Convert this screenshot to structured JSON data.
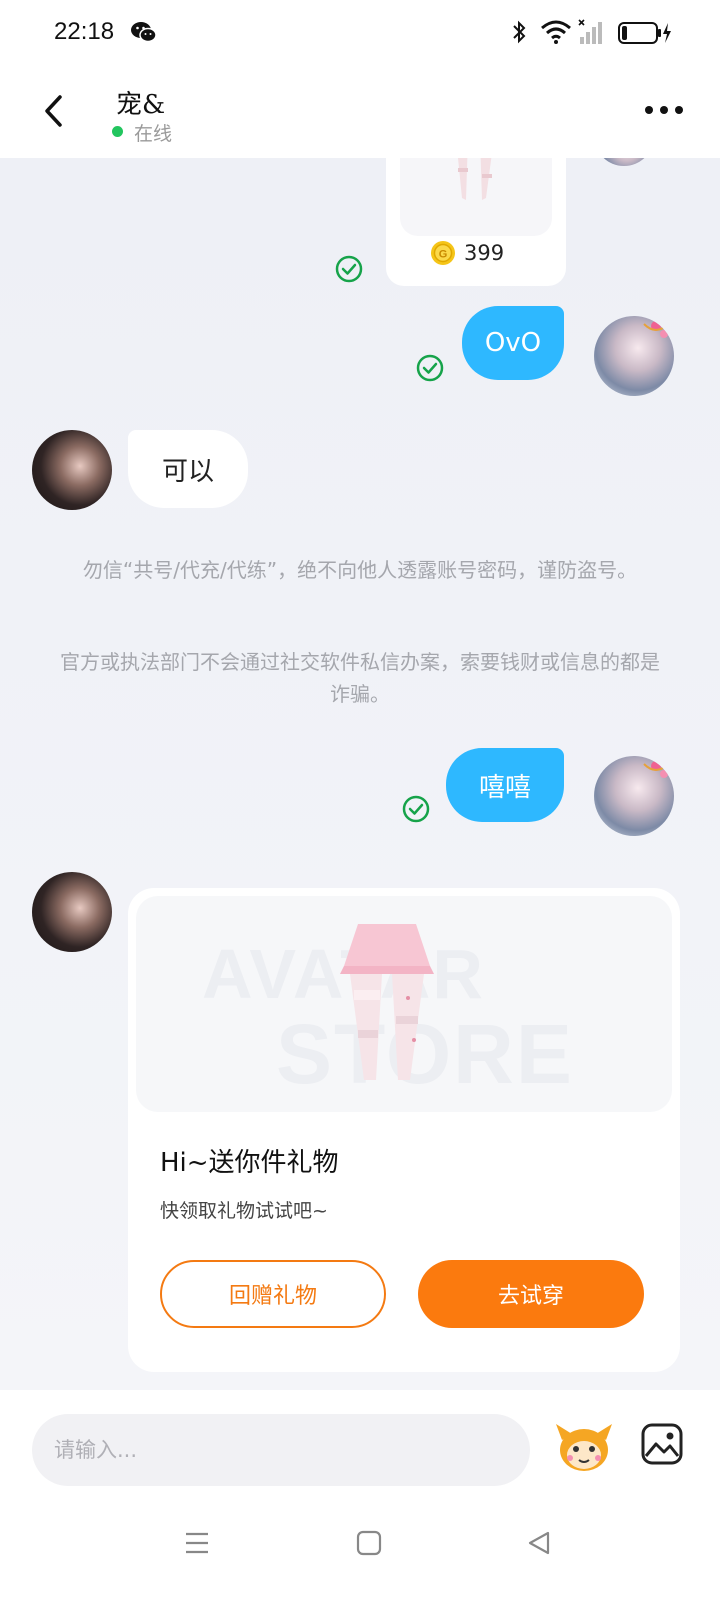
{
  "status_bar": {
    "time": "22:18"
  },
  "header": {
    "contact_name": "宠&",
    "status": "在线"
  },
  "messages": {
    "gift_top_price": "399",
    "me_1": "OvO",
    "other_1": "可以",
    "notice_1": "勿信“共号/代充/代练”，绝不向他人透露账号密码，谨防盗号。",
    "notice_2": "官方或执法部门不会通过社交软件私信办案，索要钱财或信息的都是诈骗。",
    "me_2": "嘻嘻"
  },
  "gift_card": {
    "watermark_line1": "AVATAR",
    "watermark_line2": "STORE",
    "title": "Hi~送你件礼物",
    "subtitle": "快领取礼物试试吧~",
    "return_button": "回赠礼物",
    "try_button": "去试穿"
  },
  "input": {
    "placeholder": "请输入..."
  },
  "colors": {
    "accent_blue": "#2eb8ff",
    "accent_orange": "#fb7a0e",
    "online_green": "#22c55e",
    "check_green": "#16a34a"
  },
  "icons": [
    "wechat-icon",
    "bluetooth-icon",
    "wifi-icon",
    "signal-icon",
    "battery-icon",
    "back-icon",
    "more-icon",
    "coin-icon",
    "read-check-icon",
    "mascot-icon",
    "image-icon",
    "nav-menu-icon",
    "nav-home-icon",
    "nav-back-icon"
  ]
}
